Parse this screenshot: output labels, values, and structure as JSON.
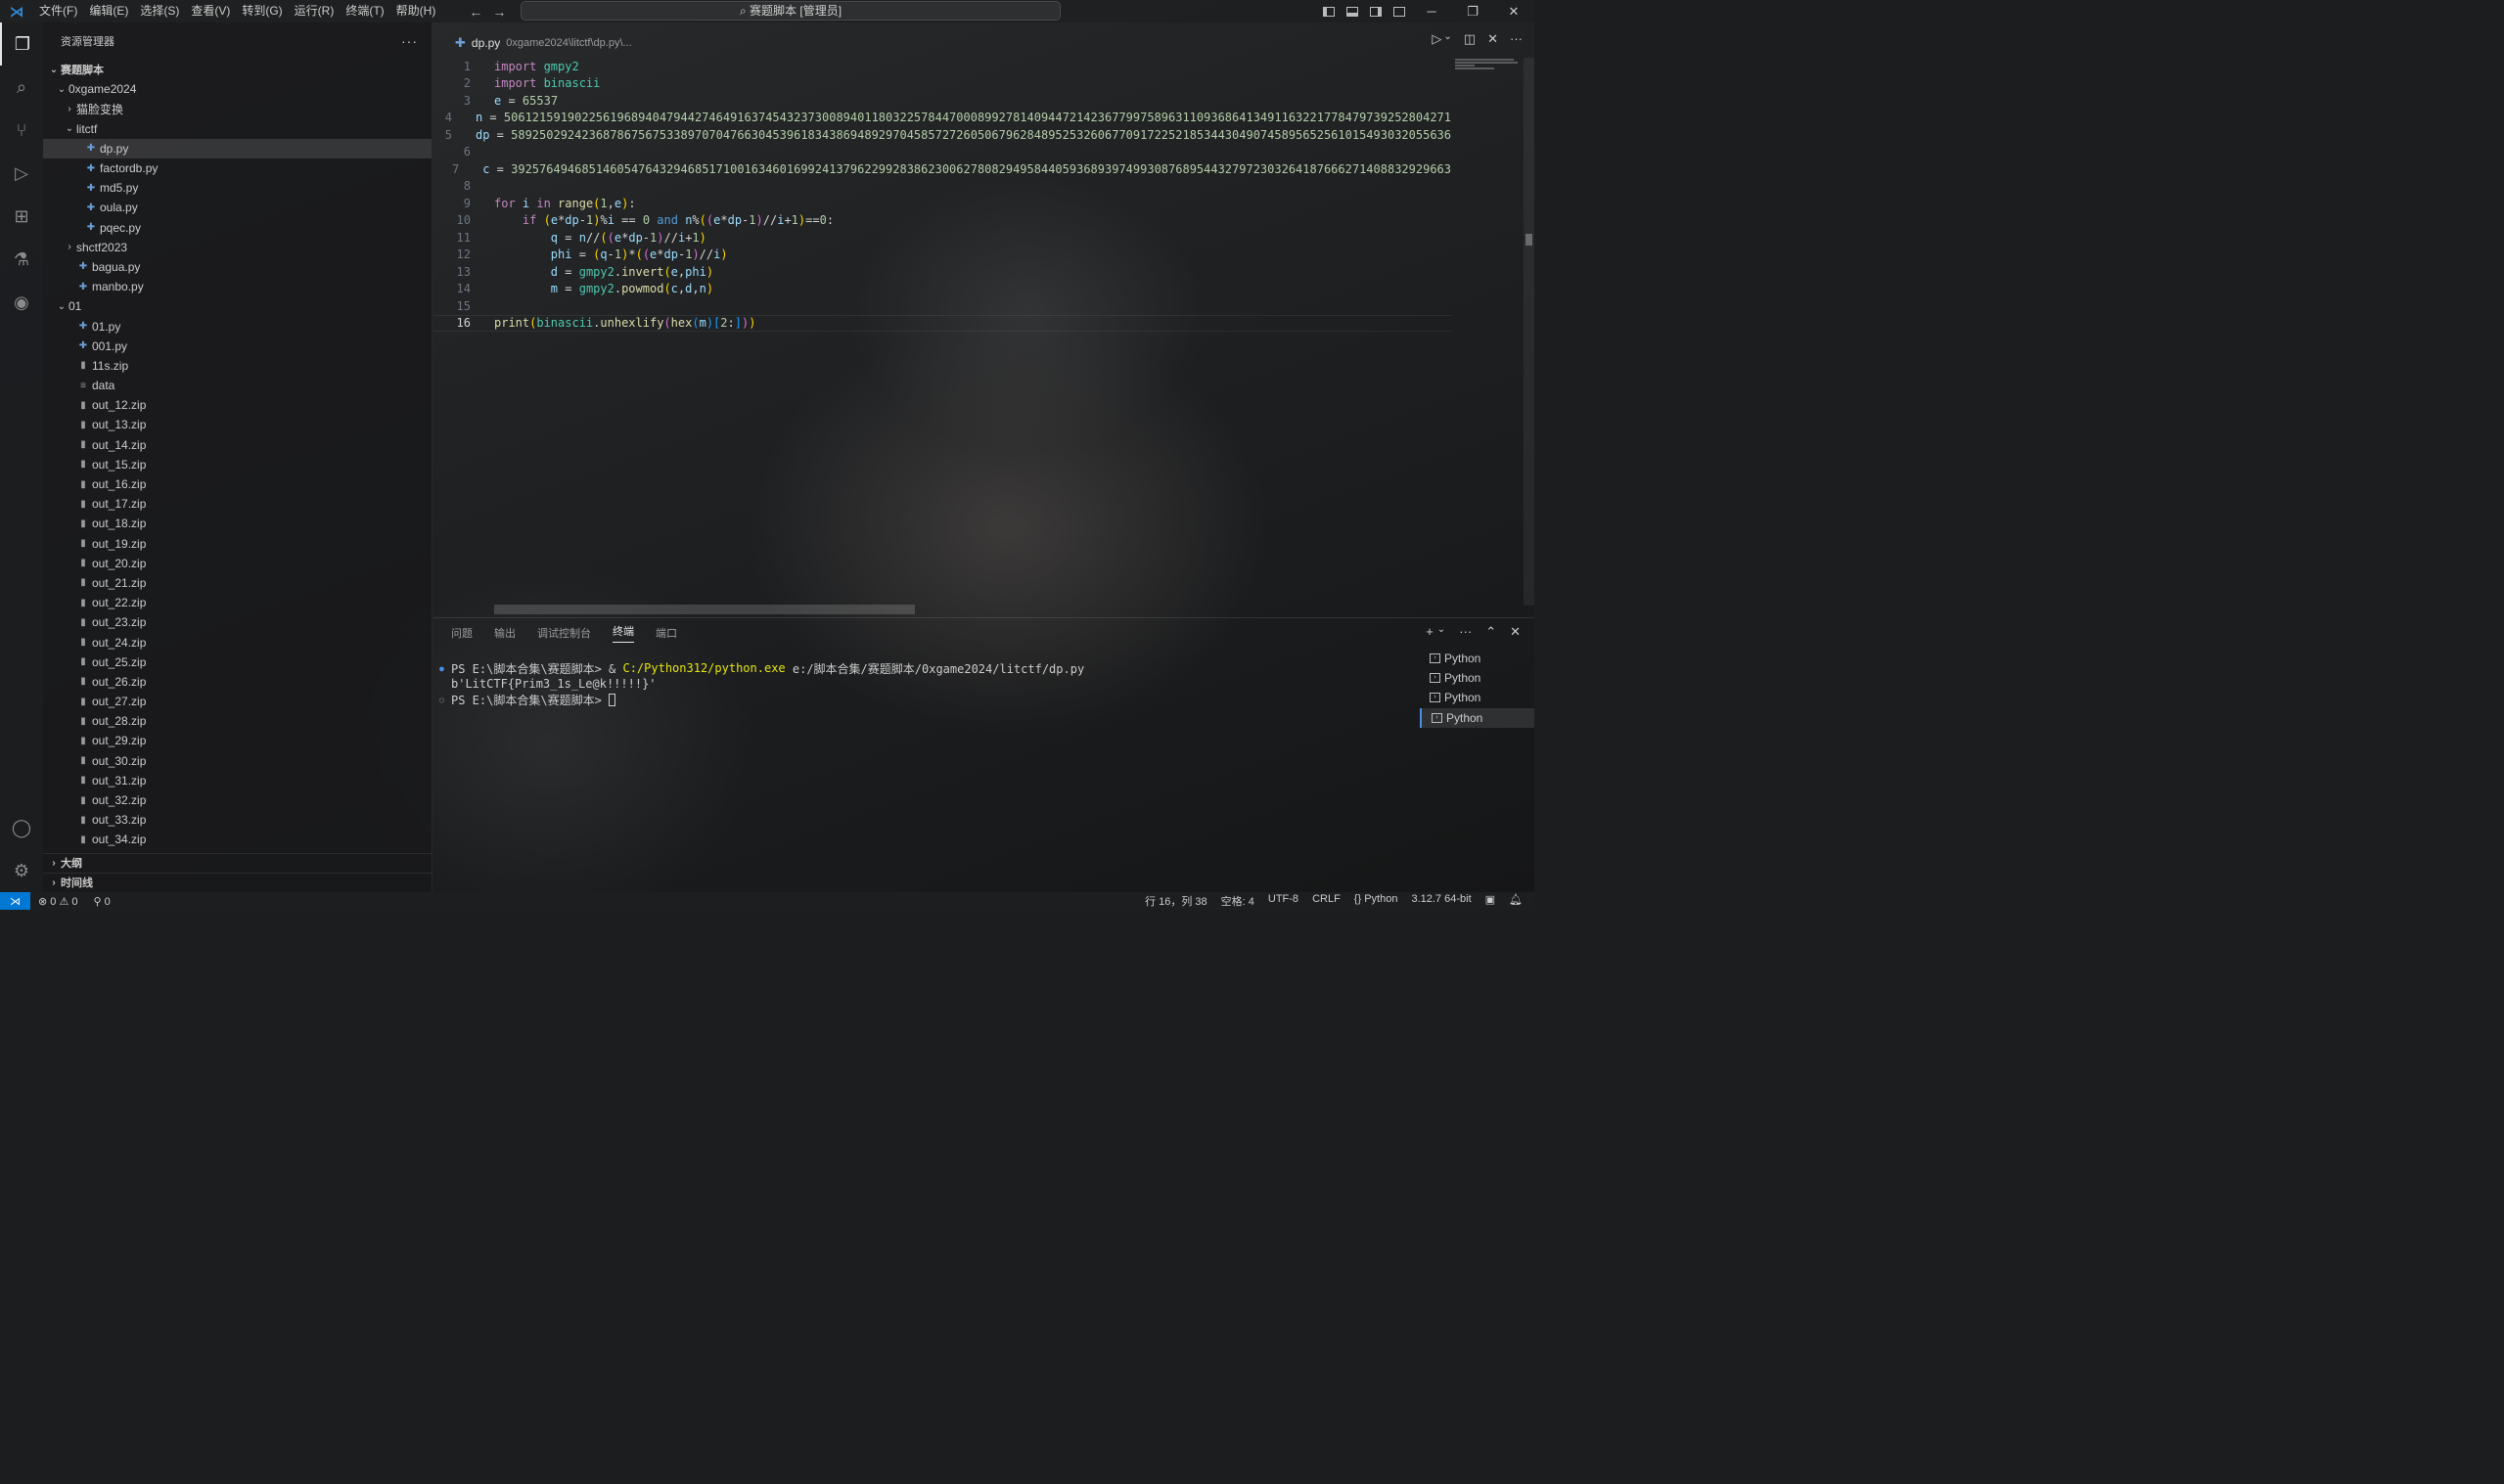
{
  "titlebar": {
    "menus": [
      "文件(F)",
      "编辑(E)",
      "选择(S)",
      "查看(V)",
      "转到(G)",
      "运行(R)",
      "终端(T)",
      "帮助(H)"
    ],
    "search_text": "赛题脚本 [管理员]"
  },
  "sidebar": {
    "title": "资源管理器",
    "more": "···",
    "root": "赛题脚本",
    "tree": [
      {
        "label": "0xgame2024",
        "depth": 1,
        "type": "folder-open"
      },
      {
        "label": "猫脸变换",
        "depth": 2,
        "type": "folder-closed"
      },
      {
        "label": "litctf",
        "depth": 2,
        "type": "folder-open"
      },
      {
        "label": "dp.py",
        "depth": 3,
        "type": "py",
        "selected": true
      },
      {
        "label": "factordb.py",
        "depth": 3,
        "type": "py"
      },
      {
        "label": "md5.py",
        "depth": 3,
        "type": "py"
      },
      {
        "label": "oula.py",
        "depth": 3,
        "type": "py"
      },
      {
        "label": "pqec.py",
        "depth": 3,
        "type": "py"
      },
      {
        "label": "shctf2023",
        "depth": 2,
        "type": "folder-closed"
      },
      {
        "label": "bagua.py",
        "depth": 2,
        "type": "py"
      },
      {
        "label": "manbo.py",
        "depth": 2,
        "type": "py"
      },
      {
        "label": "01",
        "depth": 1,
        "type": "folder-open"
      },
      {
        "label": "01.py",
        "depth": 2,
        "type": "py"
      },
      {
        "label": "001.py",
        "depth": 2,
        "type": "py"
      },
      {
        "label": "11s.zip",
        "depth": 2,
        "type": "zip"
      },
      {
        "label": "data",
        "depth": 2,
        "type": "text"
      },
      {
        "label": "out_12.zip",
        "depth": 2,
        "type": "zip"
      },
      {
        "label": "out_13.zip",
        "depth": 2,
        "type": "zip"
      },
      {
        "label": "out_14.zip",
        "depth": 2,
        "type": "zip"
      },
      {
        "label": "out_15.zip",
        "depth": 2,
        "type": "zip"
      },
      {
        "label": "out_16.zip",
        "depth": 2,
        "type": "zip"
      },
      {
        "label": "out_17.zip",
        "depth": 2,
        "type": "zip"
      },
      {
        "label": "out_18.zip",
        "depth": 2,
        "type": "zip"
      },
      {
        "label": "out_19.zip",
        "depth": 2,
        "type": "zip"
      },
      {
        "label": "out_20.zip",
        "depth": 2,
        "type": "zip"
      },
      {
        "label": "out_21.zip",
        "depth": 2,
        "type": "zip"
      },
      {
        "label": "out_22.zip",
        "depth": 2,
        "type": "zip"
      },
      {
        "label": "out_23.zip",
        "depth": 2,
        "type": "zip"
      },
      {
        "label": "out_24.zip",
        "depth": 2,
        "type": "zip"
      },
      {
        "label": "out_25.zip",
        "depth": 2,
        "type": "zip"
      },
      {
        "label": "out_26.zip",
        "depth": 2,
        "type": "zip"
      },
      {
        "label": "out_27.zip",
        "depth": 2,
        "type": "zip"
      },
      {
        "label": "out_28.zip",
        "depth": 2,
        "type": "zip"
      },
      {
        "label": "out_29.zip",
        "depth": 2,
        "type": "zip"
      },
      {
        "label": "out_30.zip",
        "depth": 2,
        "type": "zip"
      },
      {
        "label": "out_31.zip",
        "depth": 2,
        "type": "zip"
      },
      {
        "label": "out_32.zip",
        "depth": 2,
        "type": "zip"
      },
      {
        "label": "out_33.zip",
        "depth": 2,
        "type": "zip"
      },
      {
        "label": "out_34.zip",
        "depth": 2,
        "type": "zip"
      }
    ],
    "sections": [
      "大纲",
      "时间线"
    ]
  },
  "editor": {
    "tab_name": "dp.py",
    "tab_path": "0xgame2024\\litctf\\dp.py\\...",
    "current_line": 16,
    "lines": [
      {
        "n": 1,
        "tokens": [
          [
            "kw",
            "import "
          ],
          [
            "mod",
            "gmpy2"
          ]
        ]
      },
      {
        "n": 2,
        "tokens": [
          [
            "kw",
            "import "
          ],
          [
            "mod",
            "binascii"
          ]
        ]
      },
      {
        "n": 3,
        "tokens": [
          [
            "var",
            "e"
          ],
          [
            "",
            " = "
          ],
          [
            "num",
            "65537"
          ]
        ]
      },
      {
        "n": 4,
        "tokens": [
          [
            "var",
            "n"
          ],
          [
            "",
            " = "
          ],
          [
            "num",
            "50612159190225619689404794427464916374543237300894011803225784470008992781409447214236779975896311093686413491163221778479739252804271"
          ]
        ]
      },
      {
        "n": 5,
        "tokens": [
          [
            "var",
            "dp"
          ],
          [
            "",
            " = "
          ],
          [
            "num",
            "5892502924236878675675338970704766304539618343869489297045857272605067962848952532606770917225218534430490745895652561015493032055636"
          ]
        ]
      },
      {
        "n": 6,
        "tokens": []
      },
      {
        "n": 7,
        "tokens": [
          [
            "var",
            "c"
          ],
          [
            "",
            " = "
          ],
          [
            "num",
            "3925764946851460547643294685171001634601699241379622992838623006278082949584405936893974993087689544327972303264187666271408832929663"
          ]
        ]
      },
      {
        "n": 8,
        "tokens": []
      },
      {
        "n": 9,
        "tokens": [
          [
            "kw",
            "for "
          ],
          [
            "var",
            "i"
          ],
          [
            "kw",
            " in "
          ],
          [
            "fn",
            "range"
          ],
          [
            "bk1",
            "("
          ],
          [
            "num",
            "1"
          ],
          [
            "",
            ","
          ],
          [
            "var",
            "e"
          ],
          [
            "bk1",
            ")"
          ],
          [
            "",
            ":"
          ]
        ]
      },
      {
        "n": 10,
        "tokens": [
          [
            "",
            "    "
          ],
          [
            "kw",
            "if "
          ],
          [
            "bk1",
            "("
          ],
          [
            "var",
            "e"
          ],
          [
            "",
            "*"
          ],
          [
            "var",
            "dp"
          ],
          [
            "",
            "-"
          ],
          [
            "num",
            "1"
          ],
          [
            "bk1",
            ")"
          ],
          [
            "",
            "%"
          ],
          [
            "var",
            "i"
          ],
          [
            "",
            " == "
          ],
          [
            "num",
            "0"
          ],
          [
            "kw2",
            " and "
          ],
          [
            "var",
            "n"
          ],
          [
            "",
            "%"
          ],
          [
            "bk1",
            "("
          ],
          [
            "bk2",
            "("
          ],
          [
            "var",
            "e"
          ],
          [
            "",
            "*"
          ],
          [
            "var",
            "dp"
          ],
          [
            "",
            "-"
          ],
          [
            "num",
            "1"
          ],
          [
            "bk2",
            ")"
          ],
          [
            "",
            "//"
          ],
          [
            "var",
            "i"
          ],
          [
            "",
            "+"
          ],
          [
            "num",
            "1"
          ],
          [
            "bk1",
            ")"
          ],
          [
            "",
            "=="
          ],
          [
            "num",
            "0"
          ],
          [
            "",
            ":"
          ]
        ]
      },
      {
        "n": 11,
        "tokens": [
          [
            "",
            "        "
          ],
          [
            "var",
            "q"
          ],
          [
            "",
            " = "
          ],
          [
            "var",
            "n"
          ],
          [
            "",
            "//"
          ],
          [
            "bk1",
            "("
          ],
          [
            "bk2",
            "("
          ],
          [
            "var",
            "e"
          ],
          [
            "",
            "*"
          ],
          [
            "var",
            "dp"
          ],
          [
            "",
            "-"
          ],
          [
            "num",
            "1"
          ],
          [
            "bk2",
            ")"
          ],
          [
            "",
            "//"
          ],
          [
            "var",
            "i"
          ],
          [
            "",
            "+"
          ],
          [
            "num",
            "1"
          ],
          [
            "bk1",
            ")"
          ]
        ]
      },
      {
        "n": 12,
        "tokens": [
          [
            "",
            "        "
          ],
          [
            "var",
            "phi"
          ],
          [
            "",
            " = "
          ],
          [
            "bk1",
            "("
          ],
          [
            "var",
            "q"
          ],
          [
            "",
            "-"
          ],
          [
            "num",
            "1"
          ],
          [
            "bk1",
            ")"
          ],
          [
            "",
            "*"
          ],
          [
            "bk1",
            "("
          ],
          [
            "bk2",
            "("
          ],
          [
            "var",
            "e"
          ],
          [
            "",
            "*"
          ],
          [
            "var",
            "dp"
          ],
          [
            "",
            "-"
          ],
          [
            "num",
            "1"
          ],
          [
            "bk2",
            ")"
          ],
          [
            "",
            "//"
          ],
          [
            "var",
            "i"
          ],
          [
            "bk1",
            ")"
          ]
        ]
      },
      {
        "n": 13,
        "tokens": [
          [
            "",
            "        "
          ],
          [
            "var",
            "d"
          ],
          [
            "",
            " = "
          ],
          [
            "mod",
            "gmpy2"
          ],
          [
            "",
            "."
          ],
          [
            "fn",
            "invert"
          ],
          [
            "bk1",
            "("
          ],
          [
            "var",
            "e"
          ],
          [
            "",
            ","
          ],
          [
            "var",
            "phi"
          ],
          [
            "bk1",
            ")"
          ]
        ]
      },
      {
        "n": 14,
        "tokens": [
          [
            "",
            "        "
          ],
          [
            "var",
            "m"
          ],
          [
            "",
            " = "
          ],
          [
            "mod",
            "gmpy2"
          ],
          [
            "",
            "."
          ],
          [
            "fn",
            "powmod"
          ],
          [
            "bk1",
            "("
          ],
          [
            "var",
            "c"
          ],
          [
            "",
            ","
          ],
          [
            "var",
            "d"
          ],
          [
            "",
            ","
          ],
          [
            "var",
            "n"
          ],
          [
            "bk1",
            ")"
          ]
        ]
      },
      {
        "n": 15,
        "tokens": []
      },
      {
        "n": 16,
        "tokens": [
          [
            "fn",
            "print"
          ],
          [
            "bk1",
            "("
          ],
          [
            "mod",
            "binascii"
          ],
          [
            "",
            "."
          ],
          [
            "fn",
            "unhexlify"
          ],
          [
            "bk2",
            "("
          ],
          [
            "fn",
            "hex"
          ],
          [
            "bk3",
            "("
          ],
          [
            "var",
            "m"
          ],
          [
            "bk3",
            ")"
          ],
          [
            "bk3",
            "["
          ],
          [
            "num",
            "2"
          ],
          [
            "",
            ":"
          ],
          [
            "bk3",
            "]"
          ],
          [
            "bk2",
            ")"
          ],
          [
            "bk1",
            ")"
          ]
        ]
      }
    ]
  },
  "panel": {
    "tabs": [
      "问题",
      "输出",
      "调试控制台",
      "终端",
      "端口"
    ],
    "active_tab": 3,
    "terminal": {
      "line1_prompt": "PS E:\\脚本合集\\赛题脚本> & ",
      "line1_exe": "C:/Python312/python.exe",
      "line1_arg": " e:/脚本合集/赛题脚本/0xgame2024/litctf/dp.py",
      "line2": "b'LitCTF{Prim3_1s_Le@k!!!!!}'",
      "line3_prompt": "PS E:\\脚本合集\\赛题脚本> "
    },
    "terminals": [
      "Python",
      "Python",
      "Python",
      "Python"
    ],
    "active_terminal": 3
  },
  "statusbar": {
    "errors": "0",
    "warnings": "0",
    "ports": "0",
    "position": "行 16，列 38",
    "spaces": "空格: 4",
    "encoding": "UTF-8",
    "eol": "CRLF",
    "language": "Python",
    "interpreter": "3.12.7 64-bit"
  }
}
